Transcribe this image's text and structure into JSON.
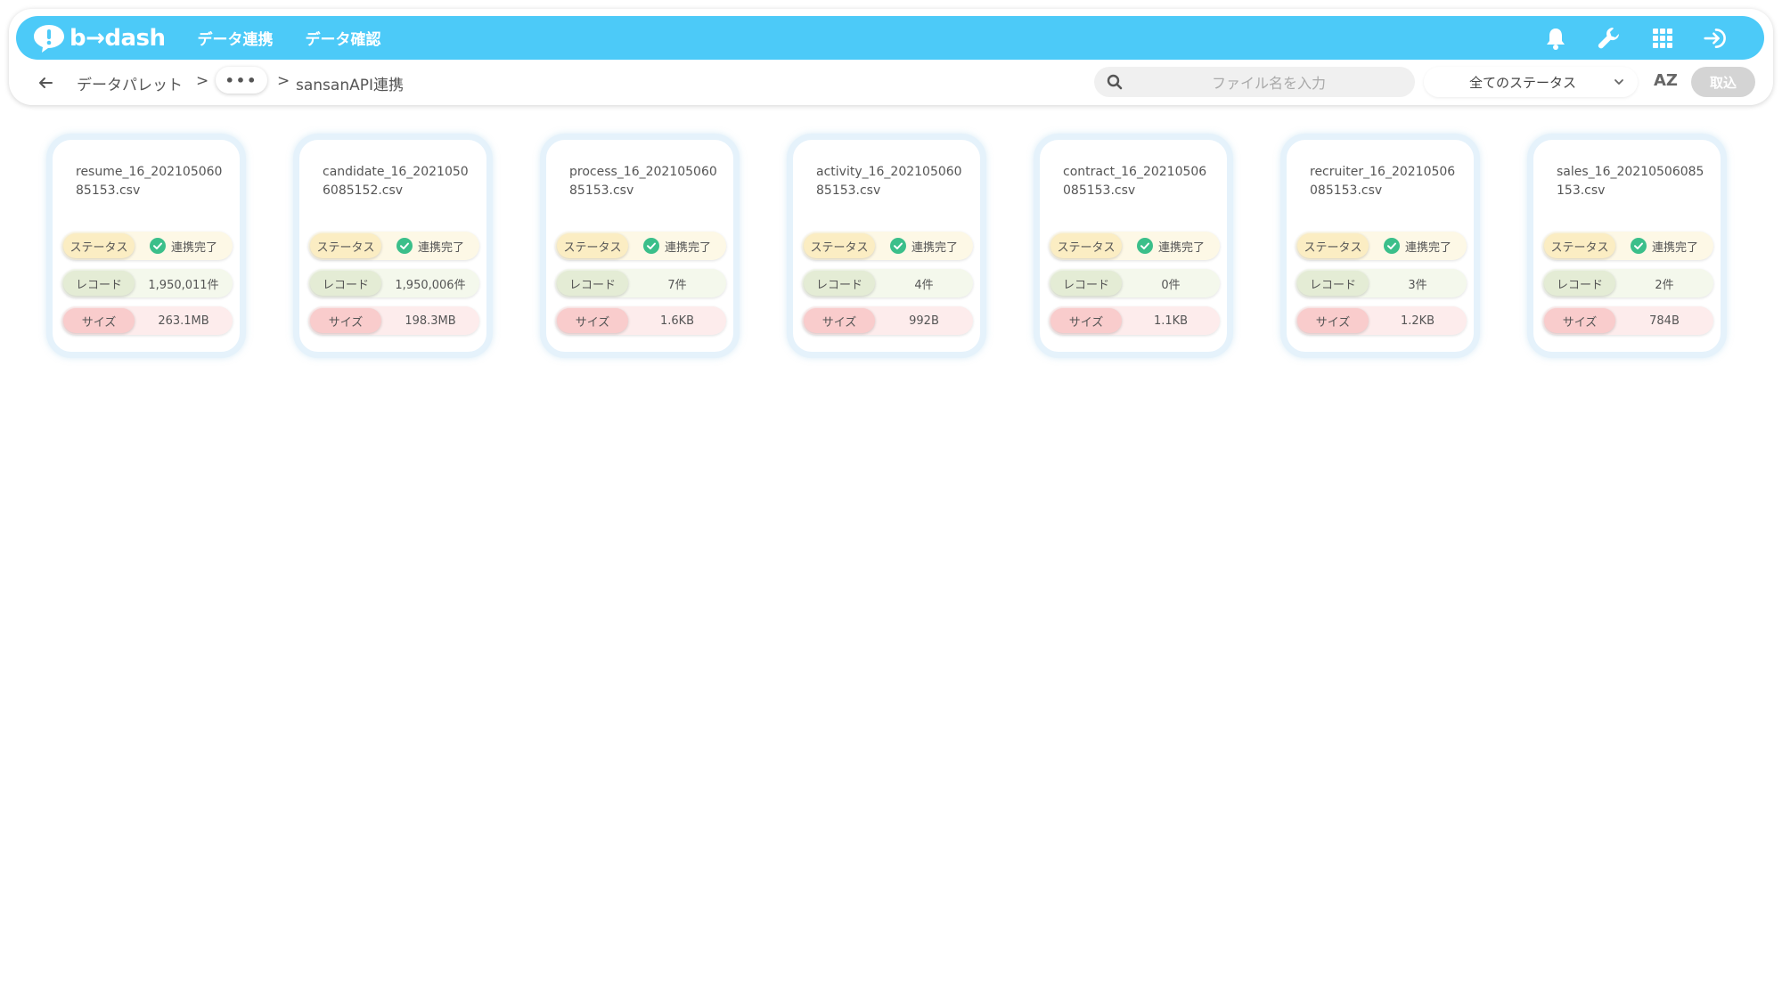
{
  "app": {
    "logo_text": "b→dash",
    "nav": [
      {
        "label": "データ連携"
      },
      {
        "label": "データ確認"
      }
    ],
    "icons": [
      "bell-icon",
      "wrench-icon",
      "grid-icon",
      "login-icon"
    ]
  },
  "toolbar": {
    "breadcrumb_root": "データパレット",
    "separator": ">",
    "ellipsis": "•••",
    "current": "sansanAPI連携",
    "search_placeholder": "ファイル名を入力",
    "status_filter": "全てのステータス",
    "sort_label": "AZ",
    "import_label": "取込"
  },
  "labels": {
    "status": "ステータス",
    "record": "レコード",
    "size": "サイズ"
  },
  "colors": {
    "header": "#4ccaf8",
    "status_ok": "#3bbf8a"
  },
  "files": [
    {
      "name": "resume_16_20210506085153.csv",
      "status": "連携完了",
      "records": "1,950,011件",
      "size": "263.1MB"
    },
    {
      "name": "candidate_16_20210506085152.csv",
      "status": "連携完了",
      "records": "1,950,006件",
      "size": "198.3MB"
    },
    {
      "name": "process_16_20210506085153.csv",
      "status": "連携完了",
      "records": "7件",
      "size": "1.6KB"
    },
    {
      "name": "activity_16_20210506085153.csv",
      "status": "連携完了",
      "records": "4件",
      "size": "992B"
    },
    {
      "name": "contract_16_20210506085153.csv",
      "status": "連携完了",
      "records": "0件",
      "size": "1.1KB"
    },
    {
      "name": "recruiter_16_20210506085153.csv",
      "status": "連携完了",
      "records": "3件",
      "size": "1.2KB"
    },
    {
      "name": "sales_16_20210506085153.csv",
      "status": "連携完了",
      "records": "2件",
      "size": "784B"
    }
  ]
}
